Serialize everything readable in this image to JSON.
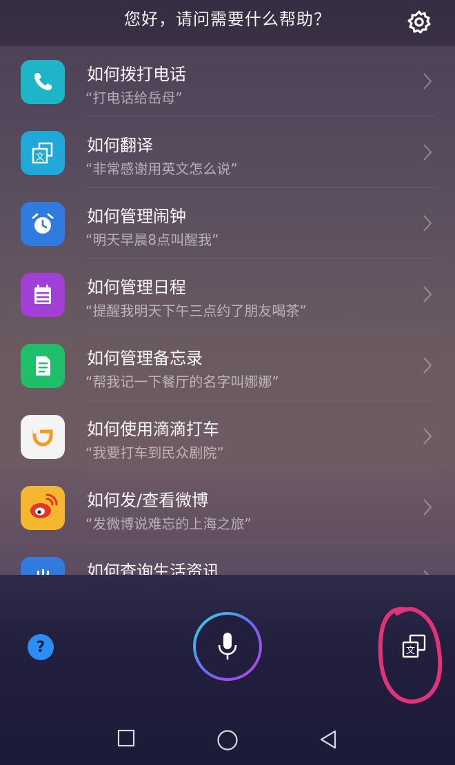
{
  "header": {
    "title": "您好，请问需要什么帮助？",
    "settings_icon": "gear-icon"
  },
  "items": [
    {
      "title": "如何拨打电话",
      "subtitle": "“打电话给岳母”",
      "icon": "phone-icon",
      "color": "#1fb5c9"
    },
    {
      "title": "如何翻译",
      "subtitle": "“非常感谢用英文怎么说”",
      "icon": "translate-icon",
      "color": "#20a8d8"
    },
    {
      "title": "如何管理闹钟",
      "subtitle": "“明天早晨8点叫醒我”",
      "icon": "alarm-clock-icon",
      "color": "#2f7be0"
    },
    {
      "title": "如何管理日程",
      "subtitle": "“提醒我明天下午三点约了朋友喝茶”",
      "icon": "calendar-icon",
      "color": "#a23fd6"
    },
    {
      "title": "如何管理备忘录",
      "subtitle": "“帮我记一下餐厅的名字叫娜娜”",
      "icon": "notepad-icon",
      "color": "#1fbf6a"
    },
    {
      "title": "如何使用滴滴打车",
      "subtitle": "“我要打车到民众剧院”",
      "icon": "didi-icon",
      "color": "#f4f4f4"
    },
    {
      "title": "如何发/查看微博",
      "subtitle": "“发微博说难忘的上海之旅”",
      "icon": "weibo-icon",
      "color": "#f5b630"
    },
    {
      "title": "如何查询生活资讯",
      "subtitle": "",
      "icon": "info-icon",
      "color": "#2f7be0"
    }
  ],
  "bottom": {
    "help_icon": "question-icon",
    "mic_icon": "microphone-icon",
    "translate_icon": "translate-icon"
  },
  "nav": {
    "recent": "square-icon",
    "home": "circle-icon",
    "back": "triangle-back-icon"
  },
  "annotation_color": "#e2337a"
}
